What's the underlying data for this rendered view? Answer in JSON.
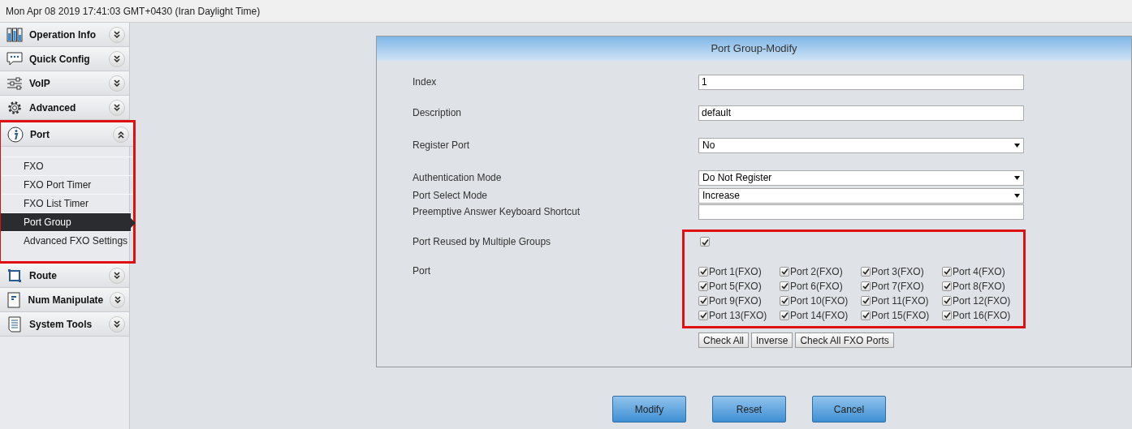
{
  "status_bar": {
    "datetime": "Mon Apr 08 2019 17:41:03 GMT+0430 (Iran Daylight Time)"
  },
  "sidebar": {
    "sections": [
      {
        "label": "Operation Info",
        "expanded": false,
        "highlighted": false
      },
      {
        "label": "Quick Config",
        "expanded": false,
        "highlighted": false
      },
      {
        "label": "VoIP",
        "expanded": false,
        "highlighted": false
      },
      {
        "label": "Advanced",
        "expanded": false,
        "highlighted": false
      },
      {
        "label": "Port",
        "expanded": true,
        "highlighted": true,
        "children": [
          {
            "label": "FXO",
            "selected": false
          },
          {
            "label": "FXO Port Timer",
            "selected": false
          },
          {
            "label": "FXO List Timer",
            "selected": false
          },
          {
            "label": "Port Group",
            "selected": true
          },
          {
            "label": "Advanced FXO Settings",
            "selected": false
          }
        ]
      },
      {
        "label": "Route",
        "expanded": false,
        "highlighted": false
      },
      {
        "label": "Num Manipulate",
        "expanded": false,
        "highlighted": false
      },
      {
        "label": "System Tools",
        "expanded": false,
        "highlighted": false
      }
    ]
  },
  "panel": {
    "title": "Port Group-Modify",
    "fields": [
      {
        "kind": "text",
        "label": "Index",
        "value": "1"
      },
      {
        "kind": "text",
        "label": "Description",
        "value": "default"
      },
      {
        "kind": "select",
        "label": "Register Port",
        "value": "No"
      },
      {
        "kind": "select",
        "label": "Authentication Mode",
        "value": "Do Not Register"
      },
      {
        "kind": "select",
        "label": "Port Select Mode",
        "value": "Increase"
      },
      {
        "kind": "text",
        "label": "Preemptive Answer Keyboard Shortcut"
      },
      {
        "kind": "checkbox",
        "label": "Port Reused by Multiple Groups",
        "checked": true
      },
      {
        "kind": "ports",
        "label": "Port",
        "ports": [
          {
            "label": "Port 1(FXO)",
            "checked": true
          },
          {
            "label": "Port 2(FXO)",
            "checked": true
          },
          {
            "label": "Port 3(FXO)",
            "checked": true
          },
          {
            "label": "Port 4(FXO)",
            "checked": true
          },
          {
            "label": "Port 5(FXO)",
            "checked": true
          },
          {
            "label": "Port 6(FXO)",
            "checked": true
          },
          {
            "label": "Port 7(FXO)",
            "checked": true
          },
          {
            "label": "Port 8(FXO)",
            "checked": true
          },
          {
            "label": "Port 9(FXO)",
            "checked": true
          },
          {
            "label": "Port 10(FXO)",
            "checked": true
          },
          {
            "label": "Port 11(FXO)",
            "checked": true
          },
          {
            "label": "Port 12(FXO)",
            "checked": true
          },
          {
            "label": "Port 13(FXO)",
            "checked": true
          },
          {
            "label": "Port 14(FXO)",
            "checked": true
          },
          {
            "label": "Port 15(FXO)",
            "checked": true
          },
          {
            "label": "Port 16(FXO)",
            "checked": true
          }
        ]
      }
    ],
    "ports_highlighted": true,
    "port_buttons": [
      "Check All",
      "Inverse",
      "Check All FXO Ports"
    ]
  },
  "actions": [
    "Modify",
    "Reset",
    "Cancel"
  ]
}
